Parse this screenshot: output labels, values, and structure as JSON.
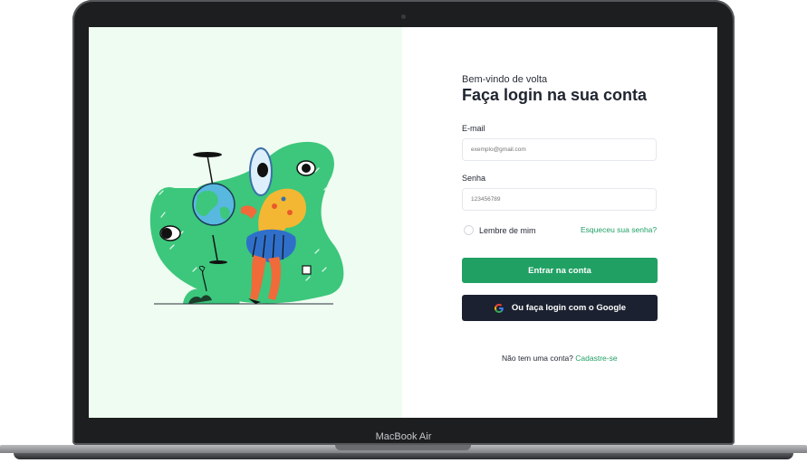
{
  "device": {
    "label": "MacBook Air"
  },
  "login": {
    "welcome": "Bem-vindo de volta",
    "title": "Faça login na sua conta",
    "email_label": "E-mail",
    "email_placeholder": "exemplo@gmail.com",
    "password_label": "Senha",
    "password_placeholder": "123456789",
    "remember_label": "Lembre de mim",
    "forgot_link": "Esqueceu sua senha?",
    "submit_label": "Entrar na conta",
    "google_label": "Ou faça login com o Google",
    "signup_prompt": "Não tem uma conta?",
    "signup_link": "Cadastre-se"
  },
  "colors": {
    "accent": "#21a064",
    "dark_button": "#1b2130",
    "left_panel_bg": "#effcf1"
  },
  "icons": {
    "google": "google-icon",
    "illustration": "person-with-globe-illustration"
  }
}
